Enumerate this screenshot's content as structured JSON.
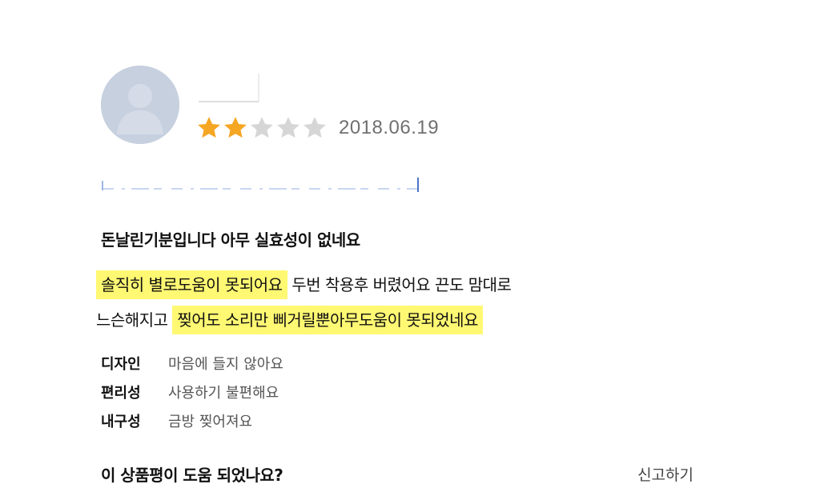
{
  "review": {
    "rating": 2,
    "max_rating": 5,
    "date": "2018.06.19",
    "title": "돈날린기분입니다 아무 실효성이 없네요",
    "body_lines": [
      [
        {
          "text": "솔직히 별로도움이 못되어요",
          "highlight": true
        },
        {
          "text": " 두번 착용후 버렸어요 끈도 맘대로",
          "highlight": false
        }
      ],
      [
        {
          "text": "느슨해지고 ",
          "highlight": false
        },
        {
          "text": "찢어도 소리만 삐거릴뿐아무도움이 못되었네요",
          "highlight": true
        }
      ]
    ],
    "attributes": [
      {
        "label": "디자인",
        "value": "마음에 들지 않아요"
      },
      {
        "label": "편리성",
        "value": "사용하기 불편해요"
      },
      {
        "label": "내구성",
        "value": "금방 찢어져요"
      }
    ]
  },
  "footer": {
    "helpful_question": "이 상품평이 도움 되었나요?",
    "report_label": "신고하기"
  },
  "colors": {
    "star_filled": "#f5a623",
    "star_empty": "#d6d6d6",
    "highlight": "#fff873",
    "avatar_bg": "#c7d0df"
  },
  "icons": {
    "avatar": "default-user-avatar-icon",
    "star": "star-icon"
  }
}
